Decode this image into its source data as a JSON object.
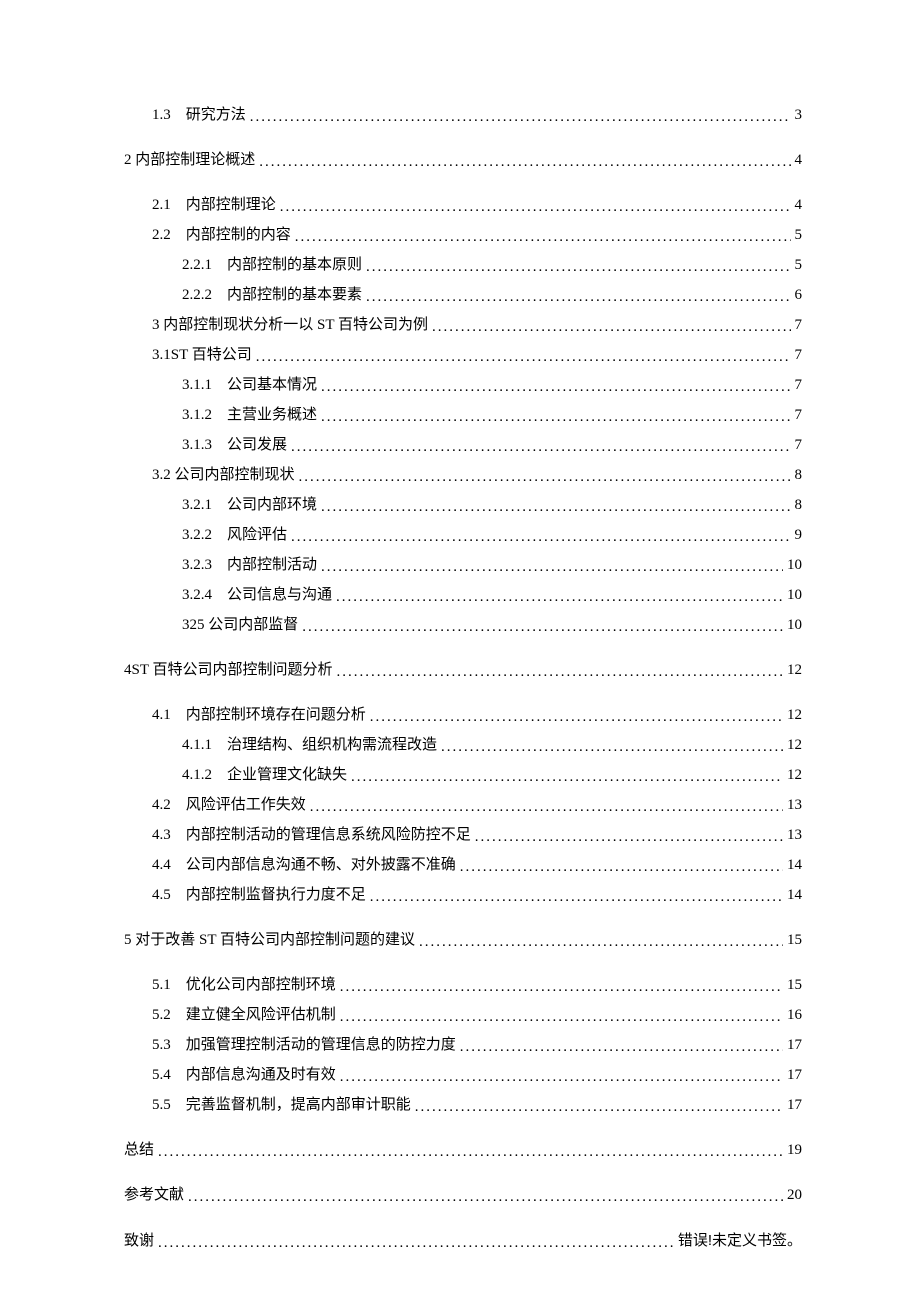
{
  "toc": [
    {
      "indent": 1,
      "label": "1.3　研究方法",
      "page": "3",
      "spaceAbove": false
    },
    {
      "indent": 0,
      "label": "2 内部控制理论概述",
      "page": "4",
      "spaceAbove": true
    },
    {
      "indent": 1,
      "label": "2.1　内部控制理论",
      "page": "4",
      "spaceAbove": true
    },
    {
      "indent": 1,
      "label": "2.2　内部控制的内容",
      "page": "5",
      "spaceAbove": false
    },
    {
      "indent": 2,
      "label": "2.2.1　内部控制的基本原则",
      "page": "5",
      "spaceAbove": false
    },
    {
      "indent": 2,
      "label": "2.2.2　内部控制的基本要素",
      "page": "6",
      "spaceAbove": false
    },
    {
      "indent": 1,
      "label": "3 内部控制现状分析一以 ST 百特公司为例",
      "page": "7",
      "spaceAbove": false
    },
    {
      "indent": 1,
      "label": "3.1ST 百特公司",
      "page": "7",
      "spaceAbove": false
    },
    {
      "indent": 2,
      "label": "3.1.1　公司基本情况",
      "page": "7",
      "spaceAbove": false
    },
    {
      "indent": 2,
      "label": "3.1.2　主营业务概述",
      "page": "7",
      "spaceAbove": false
    },
    {
      "indent": 2,
      "label": "3.1.3　公司发展",
      "page": "7",
      "spaceAbove": false
    },
    {
      "indent": 1,
      "label": "3.2 公司内部控制现状",
      "page": "8",
      "spaceAbove": false
    },
    {
      "indent": 2,
      "label": "3.2.1　公司内部环境",
      "page": "8",
      "spaceAbove": false
    },
    {
      "indent": 2,
      "label": "3.2.2　风险评估",
      "page": "9",
      "spaceAbove": false
    },
    {
      "indent": 2,
      "label": "3.2.3　内部控制活动",
      "page": "10",
      "spaceAbove": false
    },
    {
      "indent": 2,
      "label": "3.2.4　公司信息与沟通",
      "page": "10",
      "spaceAbove": false
    },
    {
      "indent": 2,
      "label": "325 公司内部监督",
      "page": "10",
      "spaceAbove": false
    },
    {
      "indent": 0,
      "label": "4ST 百特公司内部控制问题分析",
      "page": "12",
      "spaceAbove": true
    },
    {
      "indent": 1,
      "label": "4.1　内部控制环境存在问题分析",
      "page": "12",
      "spaceAbove": true
    },
    {
      "indent": 2,
      "label": "4.1.1　治理结构、组织机构需流程改造",
      "page": "12",
      "spaceAbove": false
    },
    {
      "indent": 2,
      "label": "4.1.2　企业管理文化缺失",
      "page": "12",
      "spaceAbove": false
    },
    {
      "indent": 1,
      "label": "4.2　风险评估工作失效",
      "page": "13",
      "spaceAbove": false
    },
    {
      "indent": 1,
      "label": "4.3　内部控制活动的管理信息系统风险防控不足",
      "page": "13",
      "spaceAbove": false
    },
    {
      "indent": 1,
      "label": "4.4　公司内部信息沟通不畅、对外披露不准确",
      "page": "14",
      "spaceAbove": false
    },
    {
      "indent": 1,
      "label": "4.5　内部控制监督执行力度不足",
      "page": "14",
      "spaceAbove": false
    },
    {
      "indent": 0,
      "label": "5 对于改善 ST 百特公司内部控制问题的建议",
      "page": "15",
      "spaceAbove": true
    },
    {
      "indent": 1,
      "label": "5.1　优化公司内部控制环境",
      "page": "15",
      "spaceAbove": true
    },
    {
      "indent": 1,
      "label": "5.2　建立健全风险评估机制",
      "page": "16",
      "spaceAbove": false
    },
    {
      "indent": 1,
      "label": "5.3　加强管理控制活动的管理信息的防控力度",
      "page": "17",
      "spaceAbove": false
    },
    {
      "indent": 1,
      "label": "5.4　内部信息沟通及时有效",
      "page": "17",
      "spaceAbove": false
    },
    {
      "indent": 1,
      "label": "5.5　完善监督机制，提高内部审计职能",
      "page": "17",
      "spaceAbove": false
    },
    {
      "indent": 0,
      "label": "总结",
      "page": "19",
      "spaceAbove": true
    },
    {
      "indent": 0,
      "label": "参考文献",
      "page": "20",
      "spaceAbove": true
    },
    {
      "indent": 0,
      "label": "致谢",
      "page": "错误!未定义书签。",
      "spaceAbove": true,
      "error": true
    }
  ]
}
